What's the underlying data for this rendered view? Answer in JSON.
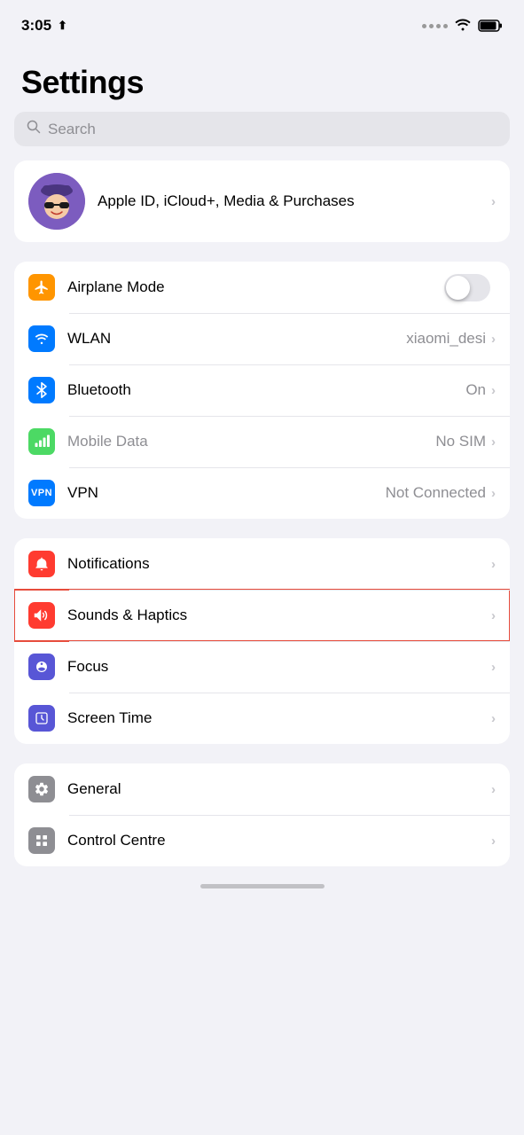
{
  "statusBar": {
    "time": "3:05",
    "hasLocation": true
  },
  "pageTitle": "Settings",
  "searchBar": {
    "placeholder": "Search"
  },
  "profile": {
    "name": "Apple ID, iCloud+, Media & Purchases",
    "avatarEmoji": "🤖"
  },
  "connectivity": [
    {
      "id": "airplane-mode",
      "label": "Airplane Mode",
      "value": "",
      "hasToggle": true,
      "toggleOn": false,
      "iconBg": "bg-orange",
      "iconChar": "✈"
    },
    {
      "id": "wlan",
      "label": "WLAN",
      "value": "xiaomi_desi",
      "hasToggle": false,
      "iconBg": "bg-blue",
      "iconChar": "wifi"
    },
    {
      "id": "bluetooth",
      "label": "Bluetooth",
      "value": "On",
      "hasToggle": false,
      "iconBg": "bg-blue-dark",
      "iconChar": "bt"
    },
    {
      "id": "mobile-data",
      "label": "Mobile Data",
      "value": "No SIM",
      "hasToggle": false,
      "iconBg": "bg-green",
      "iconChar": "signal",
      "dimmed": true
    },
    {
      "id": "vpn",
      "label": "VPN",
      "value": "Not Connected",
      "hasToggle": false,
      "iconBg": "bg-vpn",
      "iconChar": "VPN"
    }
  ],
  "general": [
    {
      "id": "notifications",
      "label": "Notifications",
      "value": "",
      "iconBg": "bg-red",
      "iconChar": "🔔"
    },
    {
      "id": "sounds-haptics",
      "label": "Sounds & Haptics",
      "value": "",
      "iconBg": "bg-pink-red",
      "iconChar": "🔊",
      "highlighted": true
    },
    {
      "id": "focus",
      "label": "Focus",
      "value": "",
      "iconBg": "bg-purple",
      "iconChar": "🌙"
    },
    {
      "id": "screen-time",
      "label": "Screen Time",
      "value": "",
      "iconBg": "bg-purple2",
      "iconChar": "⏳"
    }
  ],
  "system": [
    {
      "id": "general",
      "label": "General",
      "value": "",
      "iconBg": "bg-gray",
      "iconChar": "⚙"
    },
    {
      "id": "control-centre",
      "label": "Control Centre",
      "value": "",
      "iconBg": "bg-gray2",
      "iconChar": "🎛"
    }
  ]
}
